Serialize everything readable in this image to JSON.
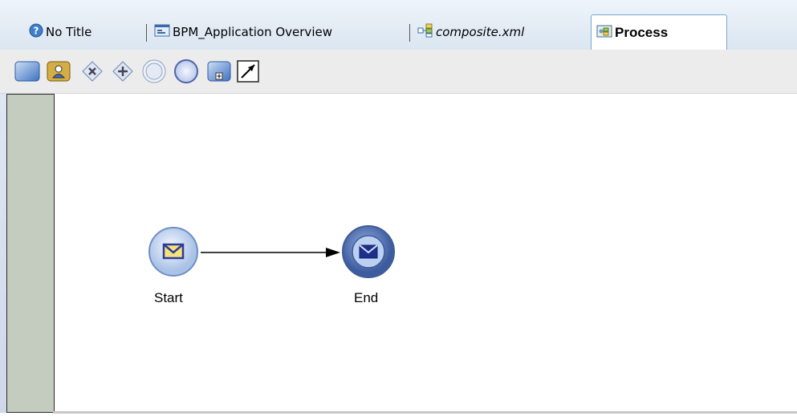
{
  "tabs": [
    {
      "label": "No Title",
      "icon": "help-icon"
    },
    {
      "label": "BPM_Application Overview",
      "icon": "overview-icon"
    },
    {
      "label": "composite.xml",
      "icon": "composite-icon"
    },
    {
      "label": "Process",
      "icon": "process-icon",
      "active": true
    }
  ],
  "toolbar": {
    "tools": [
      "activity-icon",
      "user-task-icon",
      "exclusive-gateway-icon",
      "parallel-gateway-icon",
      "intermediate-event-icon",
      "end-event-icon",
      "subprocess-icon",
      "connector-icon"
    ]
  },
  "process": {
    "start_label": "Start",
    "end_label": "End"
  },
  "colors": {
    "lane": "#c4ccbf",
    "node_fill": "#c9dbef",
    "end_fill": "#4e6fb0"
  }
}
